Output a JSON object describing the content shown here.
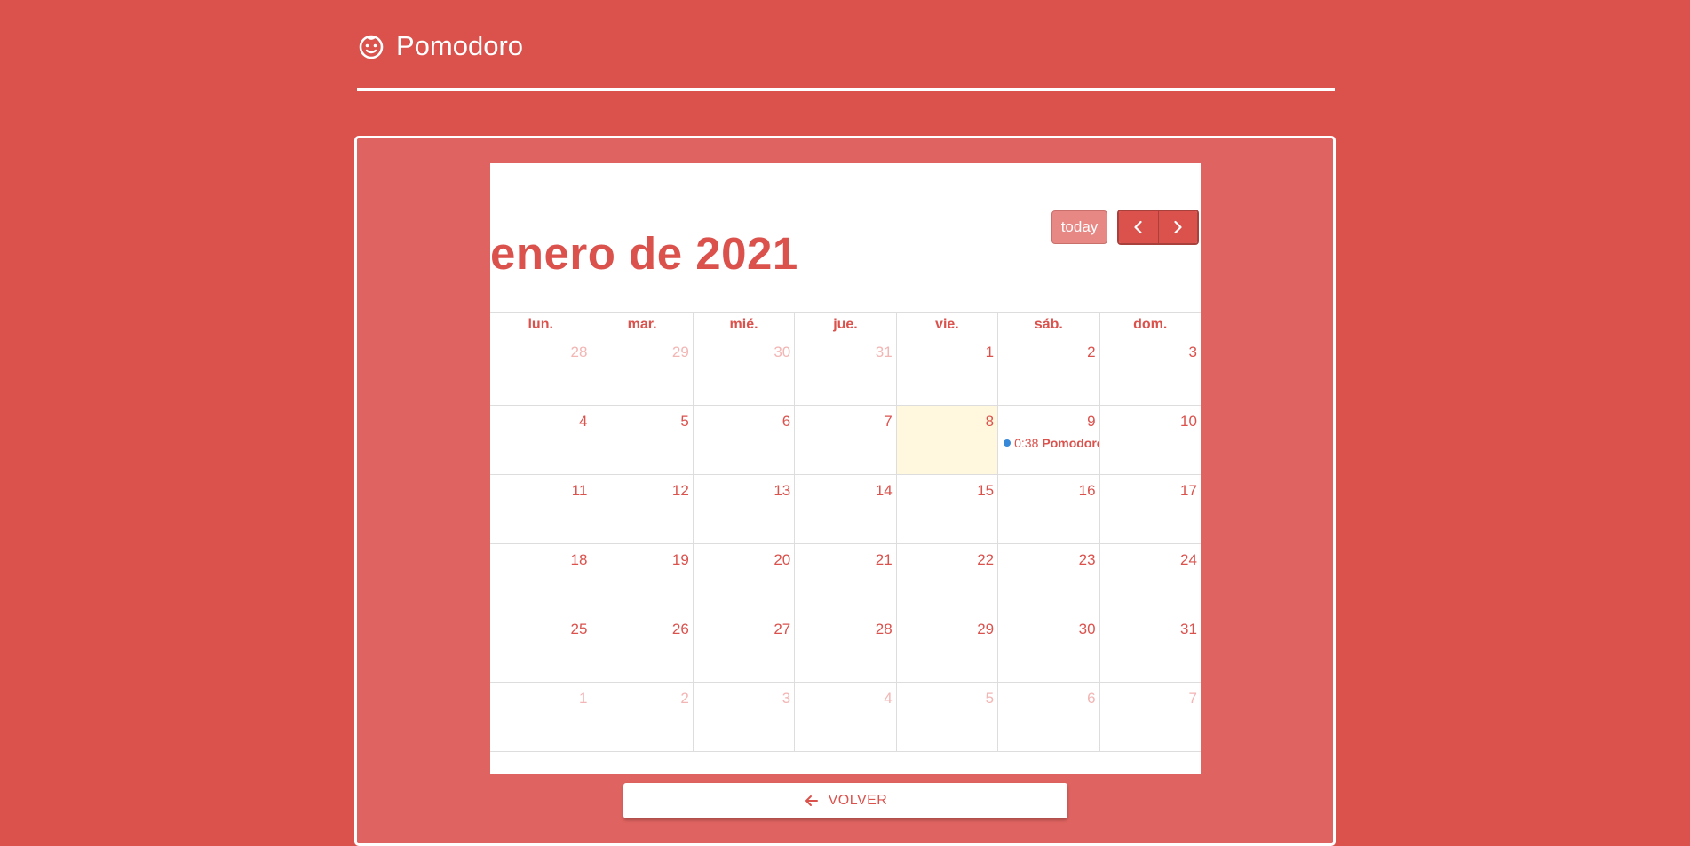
{
  "header": {
    "title": "Pomodoro",
    "icon": "baby-face-icon"
  },
  "calendar": {
    "title": "enero de 2021",
    "today_label": "today",
    "prev_icon": "chevron-left-icon",
    "next_icon": "chevron-right-icon",
    "weekdays": [
      "lun.",
      "mar.",
      "mié.",
      "jue.",
      "vie.",
      "sáb.",
      "dom."
    ],
    "weeks": [
      [
        {
          "n": "28",
          "other": true
        },
        {
          "n": "29",
          "other": true
        },
        {
          "n": "30",
          "other": true
        },
        {
          "n": "31",
          "other": true
        },
        {
          "n": "1"
        },
        {
          "n": "2"
        },
        {
          "n": "3"
        }
      ],
      [
        {
          "n": "4"
        },
        {
          "n": "5"
        },
        {
          "n": "6"
        },
        {
          "n": "7"
        },
        {
          "n": "8",
          "today": true
        },
        {
          "n": "9",
          "event": {
            "time": "0:38",
            "title": "Pomodoro"
          }
        },
        {
          "n": "10"
        }
      ],
      [
        {
          "n": "11"
        },
        {
          "n": "12"
        },
        {
          "n": "13"
        },
        {
          "n": "14"
        },
        {
          "n": "15"
        },
        {
          "n": "16"
        },
        {
          "n": "17"
        }
      ],
      [
        {
          "n": "18"
        },
        {
          "n": "19"
        },
        {
          "n": "20"
        },
        {
          "n": "21"
        },
        {
          "n": "22"
        },
        {
          "n": "23"
        },
        {
          "n": "24"
        }
      ],
      [
        {
          "n": "25"
        },
        {
          "n": "26"
        },
        {
          "n": "27"
        },
        {
          "n": "28"
        },
        {
          "n": "29"
        },
        {
          "n": "30"
        },
        {
          "n": "31"
        }
      ],
      [
        {
          "n": "1",
          "other": true
        },
        {
          "n": "2",
          "other": true
        },
        {
          "n": "3",
          "other": true
        },
        {
          "n": "4",
          "other": true
        },
        {
          "n": "5",
          "other": true
        },
        {
          "n": "6",
          "other": true
        },
        {
          "n": "7",
          "other": true
        }
      ]
    ]
  },
  "back_button": {
    "label": "VOLVER",
    "icon": "arrow-left-icon"
  },
  "colors": {
    "brand": "#db524d",
    "panel": "#df6360",
    "today_bg": "#fff8df",
    "event_dot": "#3788d8"
  }
}
